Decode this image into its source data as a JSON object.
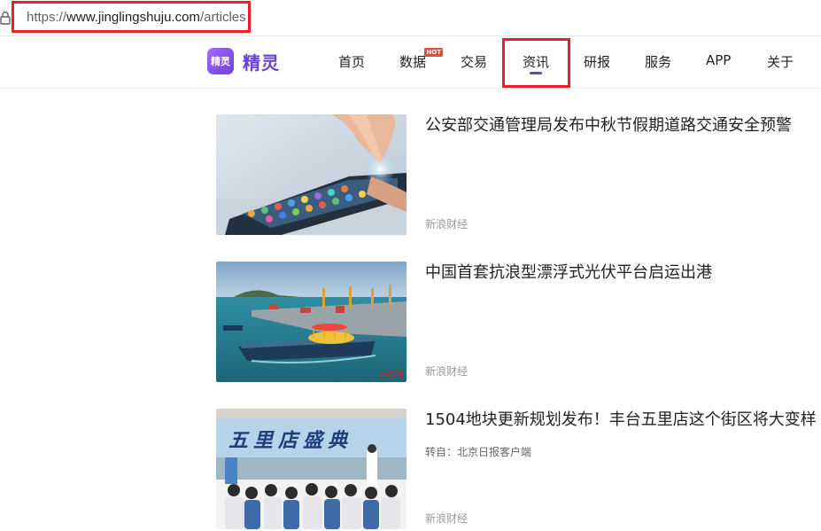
{
  "browser": {
    "url_scheme": "https://",
    "url_host": "www.jinglingshuju.com",
    "url_path": "/articles"
  },
  "site": {
    "logo_badge": "精灵",
    "logo_text": "精灵"
  },
  "nav": {
    "items": [
      {
        "label": "首页"
      },
      {
        "label": "数据",
        "badge": "HOT"
      },
      {
        "label": "交易"
      },
      {
        "label": "资讯",
        "active": true
      },
      {
        "label": "研报"
      },
      {
        "label": "服务"
      },
      {
        "label": "APP"
      },
      {
        "label": "关于"
      }
    ]
  },
  "articles": [
    {
      "title": "公安部交通管理局发布中秋节假期道路交通安全预警",
      "meta": "",
      "source": "新浪财经",
      "thumb_icon": "smartphone-apps-image"
    },
    {
      "title": "中国首套抗浪型漂浮式光伏平台启运出港",
      "meta": "",
      "source": "新浪财经",
      "thumb_icon": "harbor-barge-image",
      "watermark": "中新网"
    },
    {
      "title": "1504地块更新规划发布！丰台五里店这个街区将大变样",
      "meta": "转自：北京日报客户端",
      "source": "新浪财经",
      "thumb_icon": "conference-audience-image",
      "banner": "五里店盛典"
    }
  ],
  "colors": {
    "brand": "#6a3fd6",
    "highlight_box": "#e8202a",
    "hot_badge": "#e8483a"
  }
}
